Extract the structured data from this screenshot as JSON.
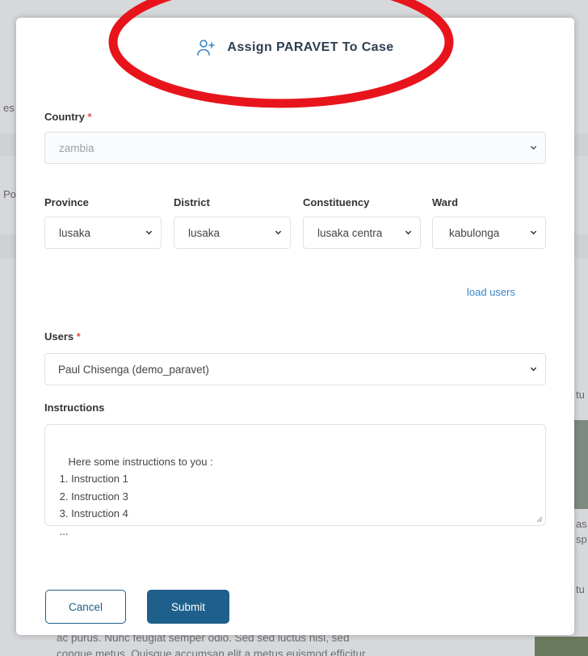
{
  "modal": {
    "title": "Assign PARAVET To Case",
    "title_icon": "user-plus-icon"
  },
  "form": {
    "country": {
      "label": "Country",
      "required_mark": "*",
      "value": "zambia"
    },
    "province": {
      "label": "Province",
      "value": "lusaka"
    },
    "district": {
      "label": "District",
      "value": "lusaka"
    },
    "constituency": {
      "label": "Constituency",
      "value": "lusaka centra"
    },
    "ward": {
      "label": "Ward",
      "value": "kabulonga"
    },
    "load_users_label": "load users",
    "users": {
      "label": "Users",
      "required_mark": "*",
      "value": "Paul Chisenga (demo_paravet)"
    },
    "instructions": {
      "label": "Instructions",
      "value": "Here some instructions to you :\n 1. Instruction 1\n 2. Instruction 3\n 3. Instruction 4\n ..."
    }
  },
  "buttons": {
    "cancel": "Cancel",
    "submit": "Submit"
  },
  "background": {
    "fragment_es": "es",
    "fragment_po": "Po",
    "fragment_tu1": "tu",
    "fragment_as": "as",
    "fragment_sp": "sp",
    "fragment_tu2": "tu",
    "bottom_text_1": "ac purus. Nunc feugiat semper odio. Sed sed luctus nisl, sed",
    "bottom_text_2": "congue metus. Quisque accumsan elit a metus euismod efficitur."
  },
  "colors": {
    "primary": "#1f5f8b",
    "link": "#3a85c4",
    "required": "#e05555",
    "annotation": "#e8141c"
  }
}
